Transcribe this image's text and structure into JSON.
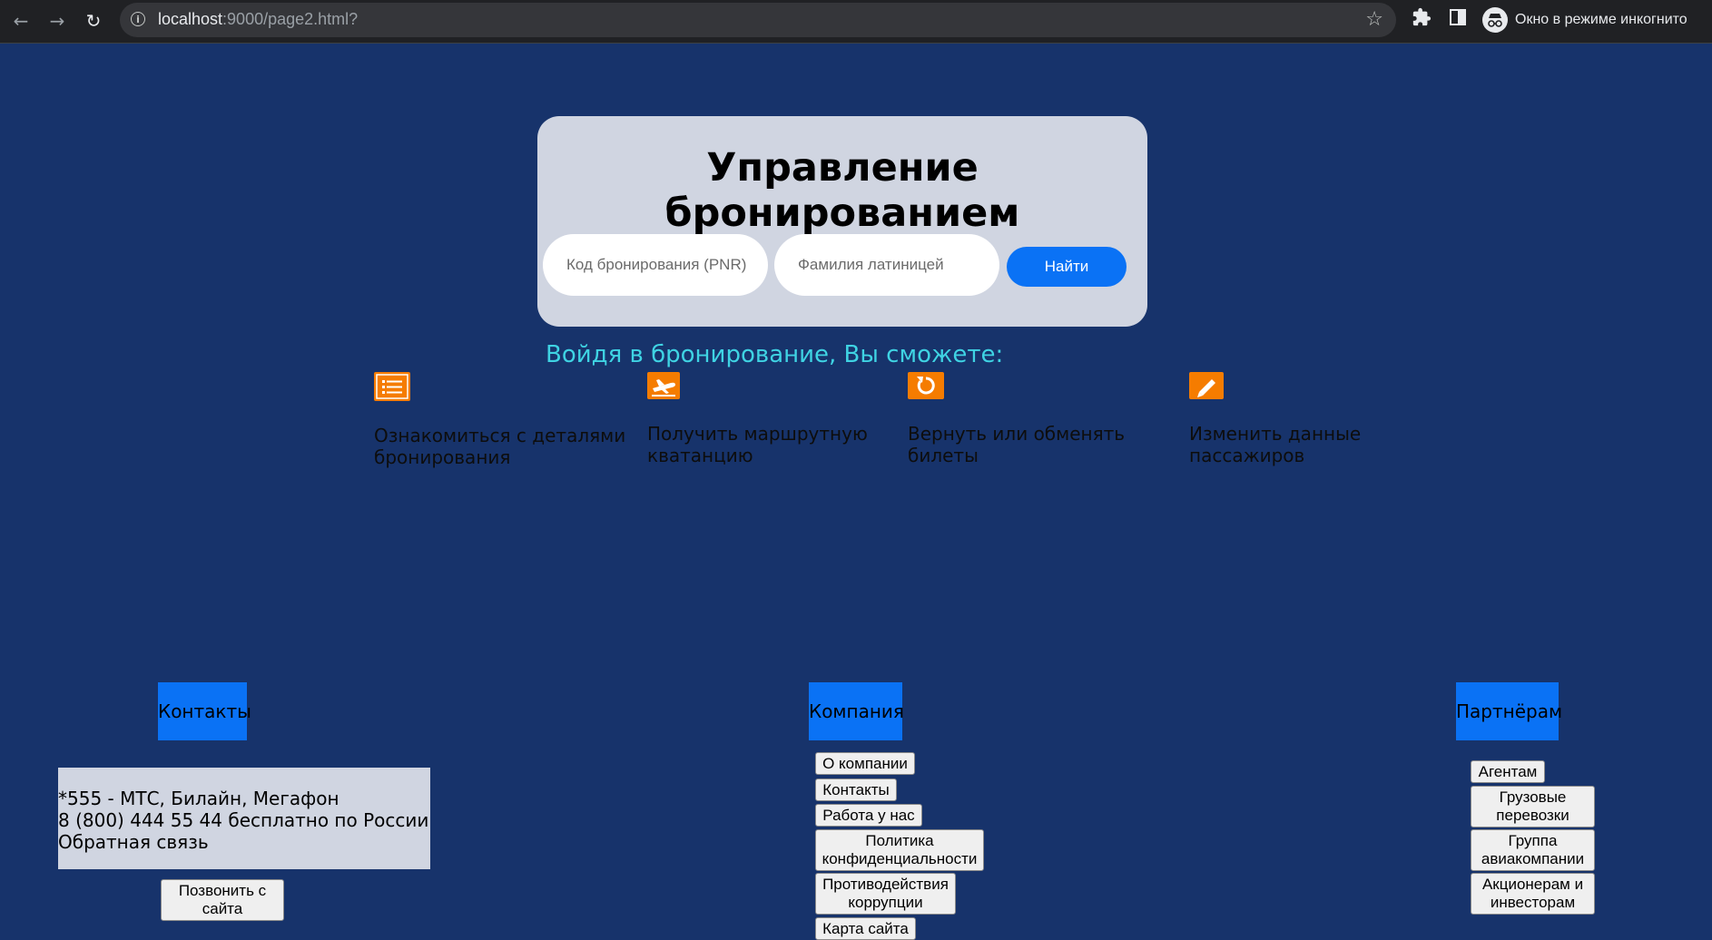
{
  "browser": {
    "url_host": "localhost",
    "url_rest": ":9000/page2.html?",
    "incognito_label": "Окно в режиме инкогнито"
  },
  "booking": {
    "title": "Управление бронированием",
    "pnr_placeholder": "Код бронирования (PNR)",
    "surname_placeholder": "Фамилия латиницей",
    "find_label": "Найти"
  },
  "features": {
    "heading": "Войдя в бронирование, Вы сможете:",
    "items": [
      {
        "icon": "list-icon",
        "line1": "Ознакомиться с деталями",
        "line2": "бронирования"
      },
      {
        "icon": "airplane-icon",
        "line1": "Получить маршрутную",
        "line2": "кватанцию"
      },
      {
        "icon": "refresh-icon",
        "line1": "Вернуть или обменять",
        "line2": "билеты"
      },
      {
        "icon": "pencil-icon",
        "line1": "Изменить данные",
        "line2": "пассажиров"
      }
    ],
    "icon_color": "#f57c00"
  },
  "footer": {
    "contacts": {
      "heading": "Контакты",
      "line1": "*555 - МТС, Билайн, Мегафон",
      "line2": "8 (800) 444 55 44 бесплатно по России",
      "line3": "Обратная связь",
      "call_button_l1": "Позвонить с",
      "call_button_l2": "сайта"
    },
    "company": {
      "heading": "Компания",
      "links": [
        {
          "l1": "О компании"
        },
        {
          "l1": "Контакты"
        },
        {
          "l1": "Работа у нас"
        },
        {
          "l1": "Политика",
          "l2": "конфиденциальности"
        },
        {
          "l1": "Противодействия",
          "l2": "коррупции"
        },
        {
          "l1": "Карта сайта"
        }
      ]
    },
    "partners": {
      "heading": "Партнёрам",
      "links": [
        {
          "l1": "Агентам"
        },
        {
          "l1": "Грузовые",
          "l2": "перевозки"
        },
        {
          "l1": "Группа",
          "l2": "авиакомпании"
        },
        {
          "l1": "Акционерам и",
          "l2": "инвесторам"
        }
      ]
    }
  },
  "colors": {
    "page_bg": "#17336b",
    "accent_blue": "#0a72f5",
    "card_bg": "#d0d5e1",
    "subtitle_cyan": "#3fd3e3"
  }
}
